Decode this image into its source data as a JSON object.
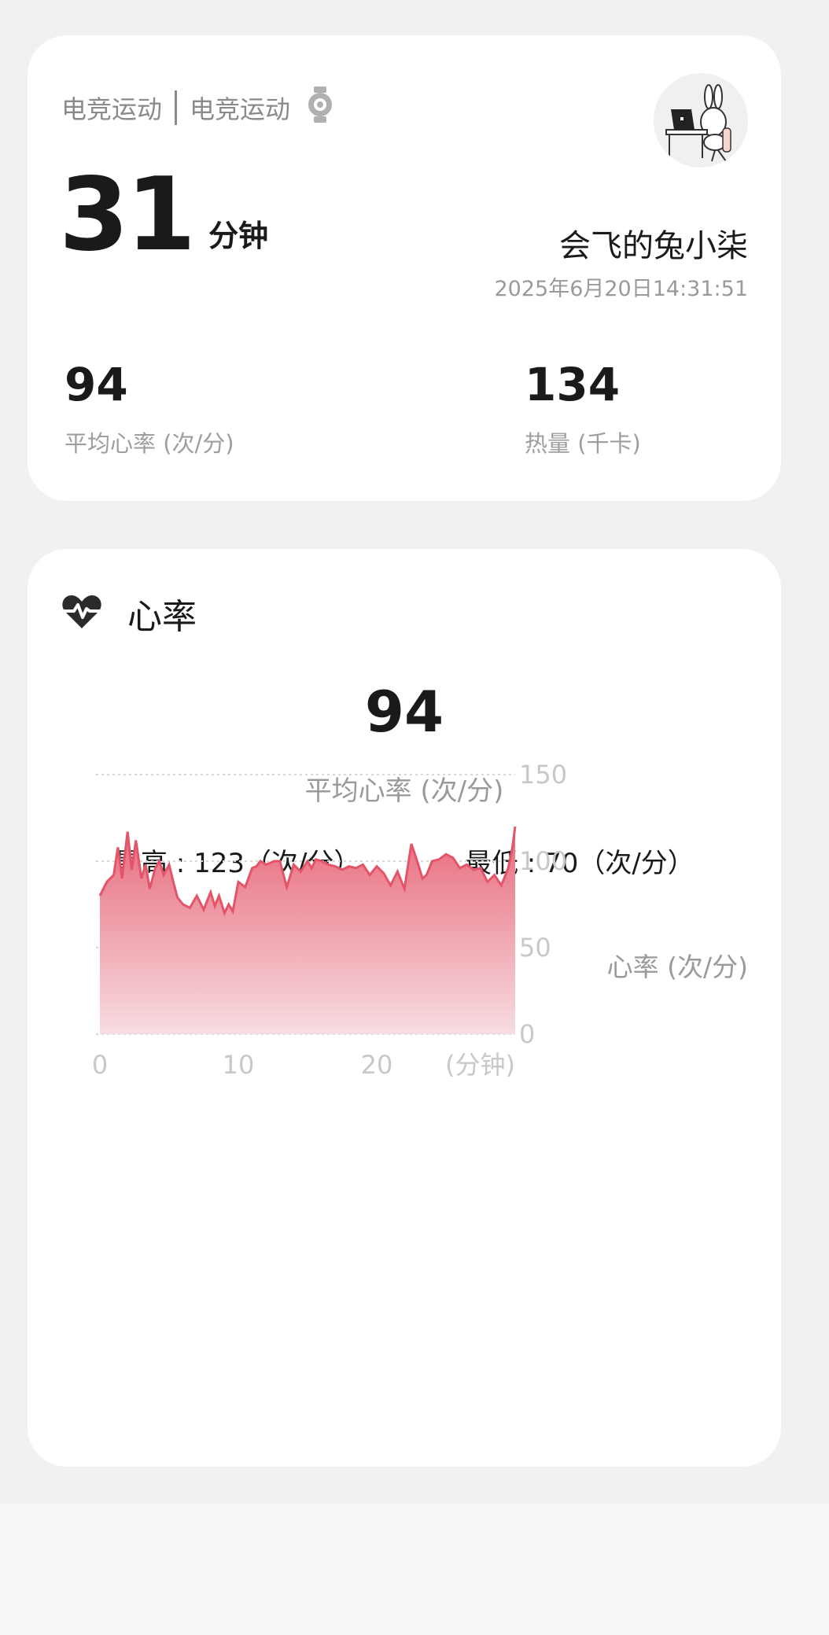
{
  "summary": {
    "sport_type_primary": "电竞运动",
    "sport_type_secondary": "电竞运动",
    "duration_value": "31",
    "duration_unit": "分钟",
    "username": "会飞的兔小柒",
    "datetime": "2025年6月20日14:31:51",
    "avg_hr_value": "94",
    "avg_hr_label": "平均心率 (次/分)",
    "calories_value": "134",
    "calories_label": "热量 (千卡)",
    "watch_icon": "smartwatch-icon",
    "avatar_icon": "rabbit-at-computer-avatar"
  },
  "heart_rate": {
    "title": "心率",
    "title_icon": "heart-pulse-icon",
    "avg_value": "94",
    "avg_label": "平均心率 (次/分)",
    "max_label": "最高 : 123（次/分）",
    "min_label": "最低 : 70（次/分）",
    "unit_label": "心率 (次/分)"
  },
  "colors": {
    "accent": "#e35468",
    "fill_top": "#e8697b",
    "fill_bottom": "#f7dde1",
    "grid": "#d8d8d8",
    "tick": "#c8c8c8"
  },
  "chart_data": {
    "type": "area",
    "ylim": [
      0,
      150
    ],
    "xlim": [
      0,
      30
    ],
    "y_ticks": [
      "150",
      "100",
      "50",
      "0"
    ],
    "x_ticks": [
      "0",
      "10",
      "20",
      "(分钟)"
    ],
    "x_tick_values": [
      0,
      10,
      20
    ],
    "grid": true,
    "x": [
      0,
      0.5,
      1,
      1.3,
      1.6,
      2,
      2.3,
      2.6,
      3,
      3.3,
      3.6,
      4,
      4.3,
      4.6,
      5,
      5.3,
      5.6,
      6,
      6.5,
      7,
      7.5,
      8,
      8.3,
      8.6,
      9,
      9.3,
      9.6,
      10,
      10.5,
      11,
      11.3,
      11.6,
      12,
      12.3,
      12.6,
      13,
      13.5,
      14,
      14.5,
      15,
      15.3,
      15.6,
      16,
      16.5,
      17,
      17.5,
      18,
      18.5,
      19,
      19.5,
      20,
      20.5,
      21,
      21.5,
      22,
      22.5,
      23,
      23.3,
      23.6,
      24,
      24.5,
      25,
      25.5,
      26,
      26.5,
      27,
      27.5,
      28,
      28.5,
      29,
      29.5,
      29.8,
      30
    ],
    "y": [
      80,
      88,
      92,
      108,
      90,
      117,
      95,
      112,
      90,
      98,
      84,
      96,
      100,
      92,
      98,
      88,
      79,
      75,
      73,
      80,
      72,
      82,
      74,
      80,
      70,
      75,
      71,
      88,
      85,
      96,
      97,
      100,
      98,
      99,
      100,
      100,
      85,
      98,
      94,
      100,
      96,
      101,
      100,
      98,
      97,
      95,
      97,
      96,
      98,
      92,
      97,
      93,
      86,
      94,
      84,
      110,
      98,
      90,
      92,
      100,
      101,
      104,
      102,
      96,
      98,
      95,
      96,
      88,
      92,
      86,
      96,
      108,
      120
    ]
  }
}
